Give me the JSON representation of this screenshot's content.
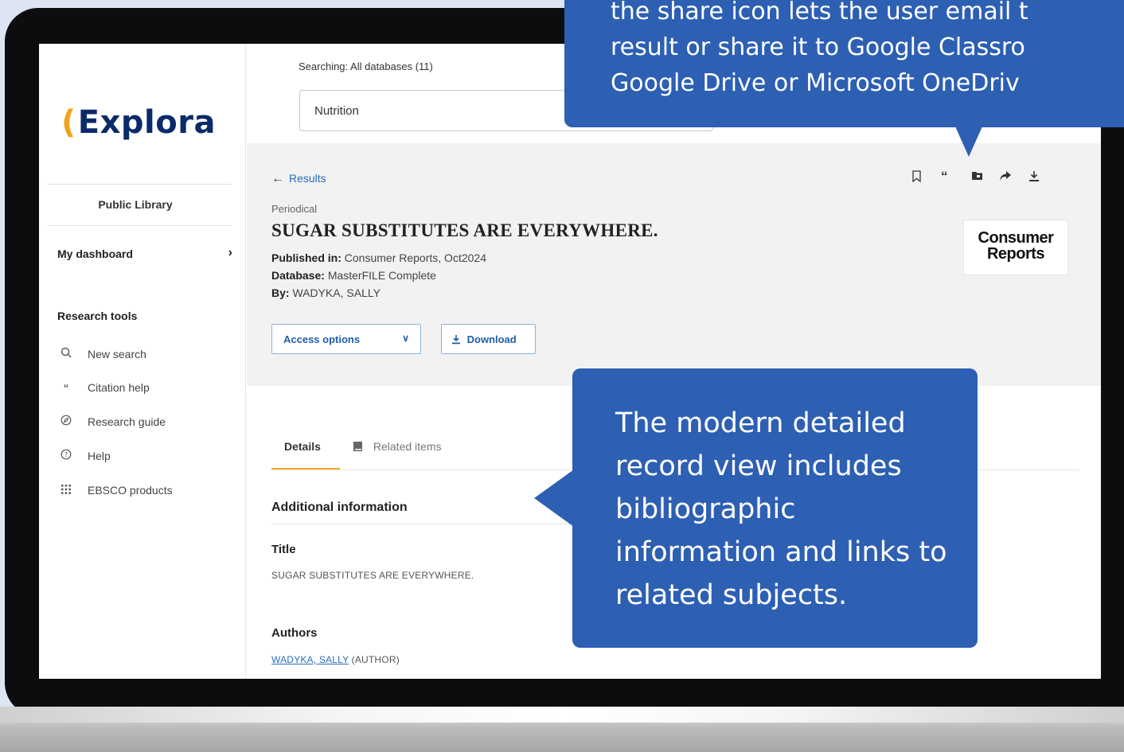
{
  "sidebar": {
    "logo": "Explora",
    "library": "Public Library",
    "dashboard": "My dashboard",
    "research_tools_heading": "Research tools",
    "tools": [
      {
        "label": "New search",
        "icon": "search-icon"
      },
      {
        "label": "Citation help",
        "icon": "quote-icon"
      },
      {
        "label": "Research guide",
        "icon": "compass-icon"
      },
      {
        "label": "Help",
        "icon": "help-icon"
      },
      {
        "label": "EBSCO products",
        "icon": "grid-icon"
      }
    ]
  },
  "search": {
    "scope": "Searching: All databases (11)",
    "value": "Nutrition"
  },
  "record": {
    "back_label": "Results",
    "type": "Periodical",
    "title": "SUGAR SUBSTITUTES ARE EVERYWHERE.",
    "published_in_label": "Published in:",
    "published_in": "Consumer Reports, Oct2024",
    "database_label": "Database:",
    "database": "MasterFILE Complete",
    "by_label": "By:",
    "by": "WADYKA, SALLY",
    "access_options": "Access options",
    "download": "Download",
    "publisher_logo_line1": "Consumer",
    "publisher_logo_line2": "Reports",
    "toolbar_icons": [
      "bookmark-icon",
      "cite-icon",
      "folder-icon",
      "share-icon",
      "download-icon"
    ]
  },
  "tabs": {
    "details": "Details",
    "related": "Related items"
  },
  "details": {
    "section_heading": "Additional information",
    "title_label": "Title",
    "title_value": "SUGAR SUBSTITUTES ARE EVERYWHERE.",
    "authors_label": "Authors",
    "author_link": "WADYKA, SALLY",
    "author_role": "(AUTHOR)"
  },
  "callouts": {
    "top_line1": "the share icon lets the user email t",
    "top_line2": "result or share it to Google Classro",
    "top_line3": "Google Drive or Microsoft OneDriv",
    "mid": "The modern detailed record view includes bibliographic information and links to related subjects."
  },
  "colors": {
    "callout": "#2d5fb3",
    "accent": "#f2a31b",
    "link": "#2a6ebb",
    "brand_navy": "#0b2a6b"
  }
}
